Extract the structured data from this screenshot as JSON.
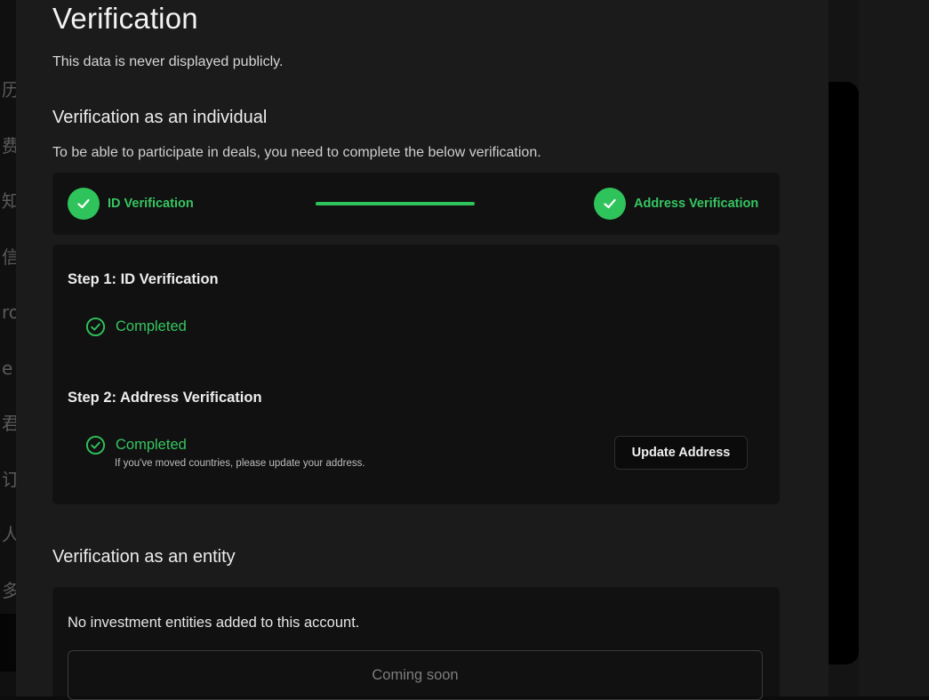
{
  "background": {
    "left_glyphs": [
      "历",
      "费",
      "知",
      "信",
      "ro",
      "e",
      "君",
      "订",
      "人",
      "多"
    ]
  },
  "modal": {
    "title": "Verification",
    "subtitle": "This data is never displayed publicly."
  },
  "individual": {
    "title": "Verification as an individual",
    "description": "To be able to participate in deals, you need to complete the below verification.",
    "progress": {
      "step1_label": "ID Verification",
      "step2_label": "Address Verification",
      "step1_icon": "check-icon",
      "step2_icon": "check-icon"
    },
    "steps": {
      "step1_title": "Step 1: ID Verification",
      "step1_status": "Completed",
      "step2_title": "Step 2: Address Verification",
      "step2_status": "Completed",
      "step2_hint": "If you've moved countries, please update your address.",
      "update_button": "Update Address"
    }
  },
  "entity": {
    "title": "Verification as an entity",
    "empty_text": "No investment entities added to this account.",
    "coming_soon_button": "Coming soon"
  },
  "colors": {
    "accent_green": "#2fc35b",
    "modal_bg": "#1b1b1b",
    "card_bg": "#111111"
  }
}
